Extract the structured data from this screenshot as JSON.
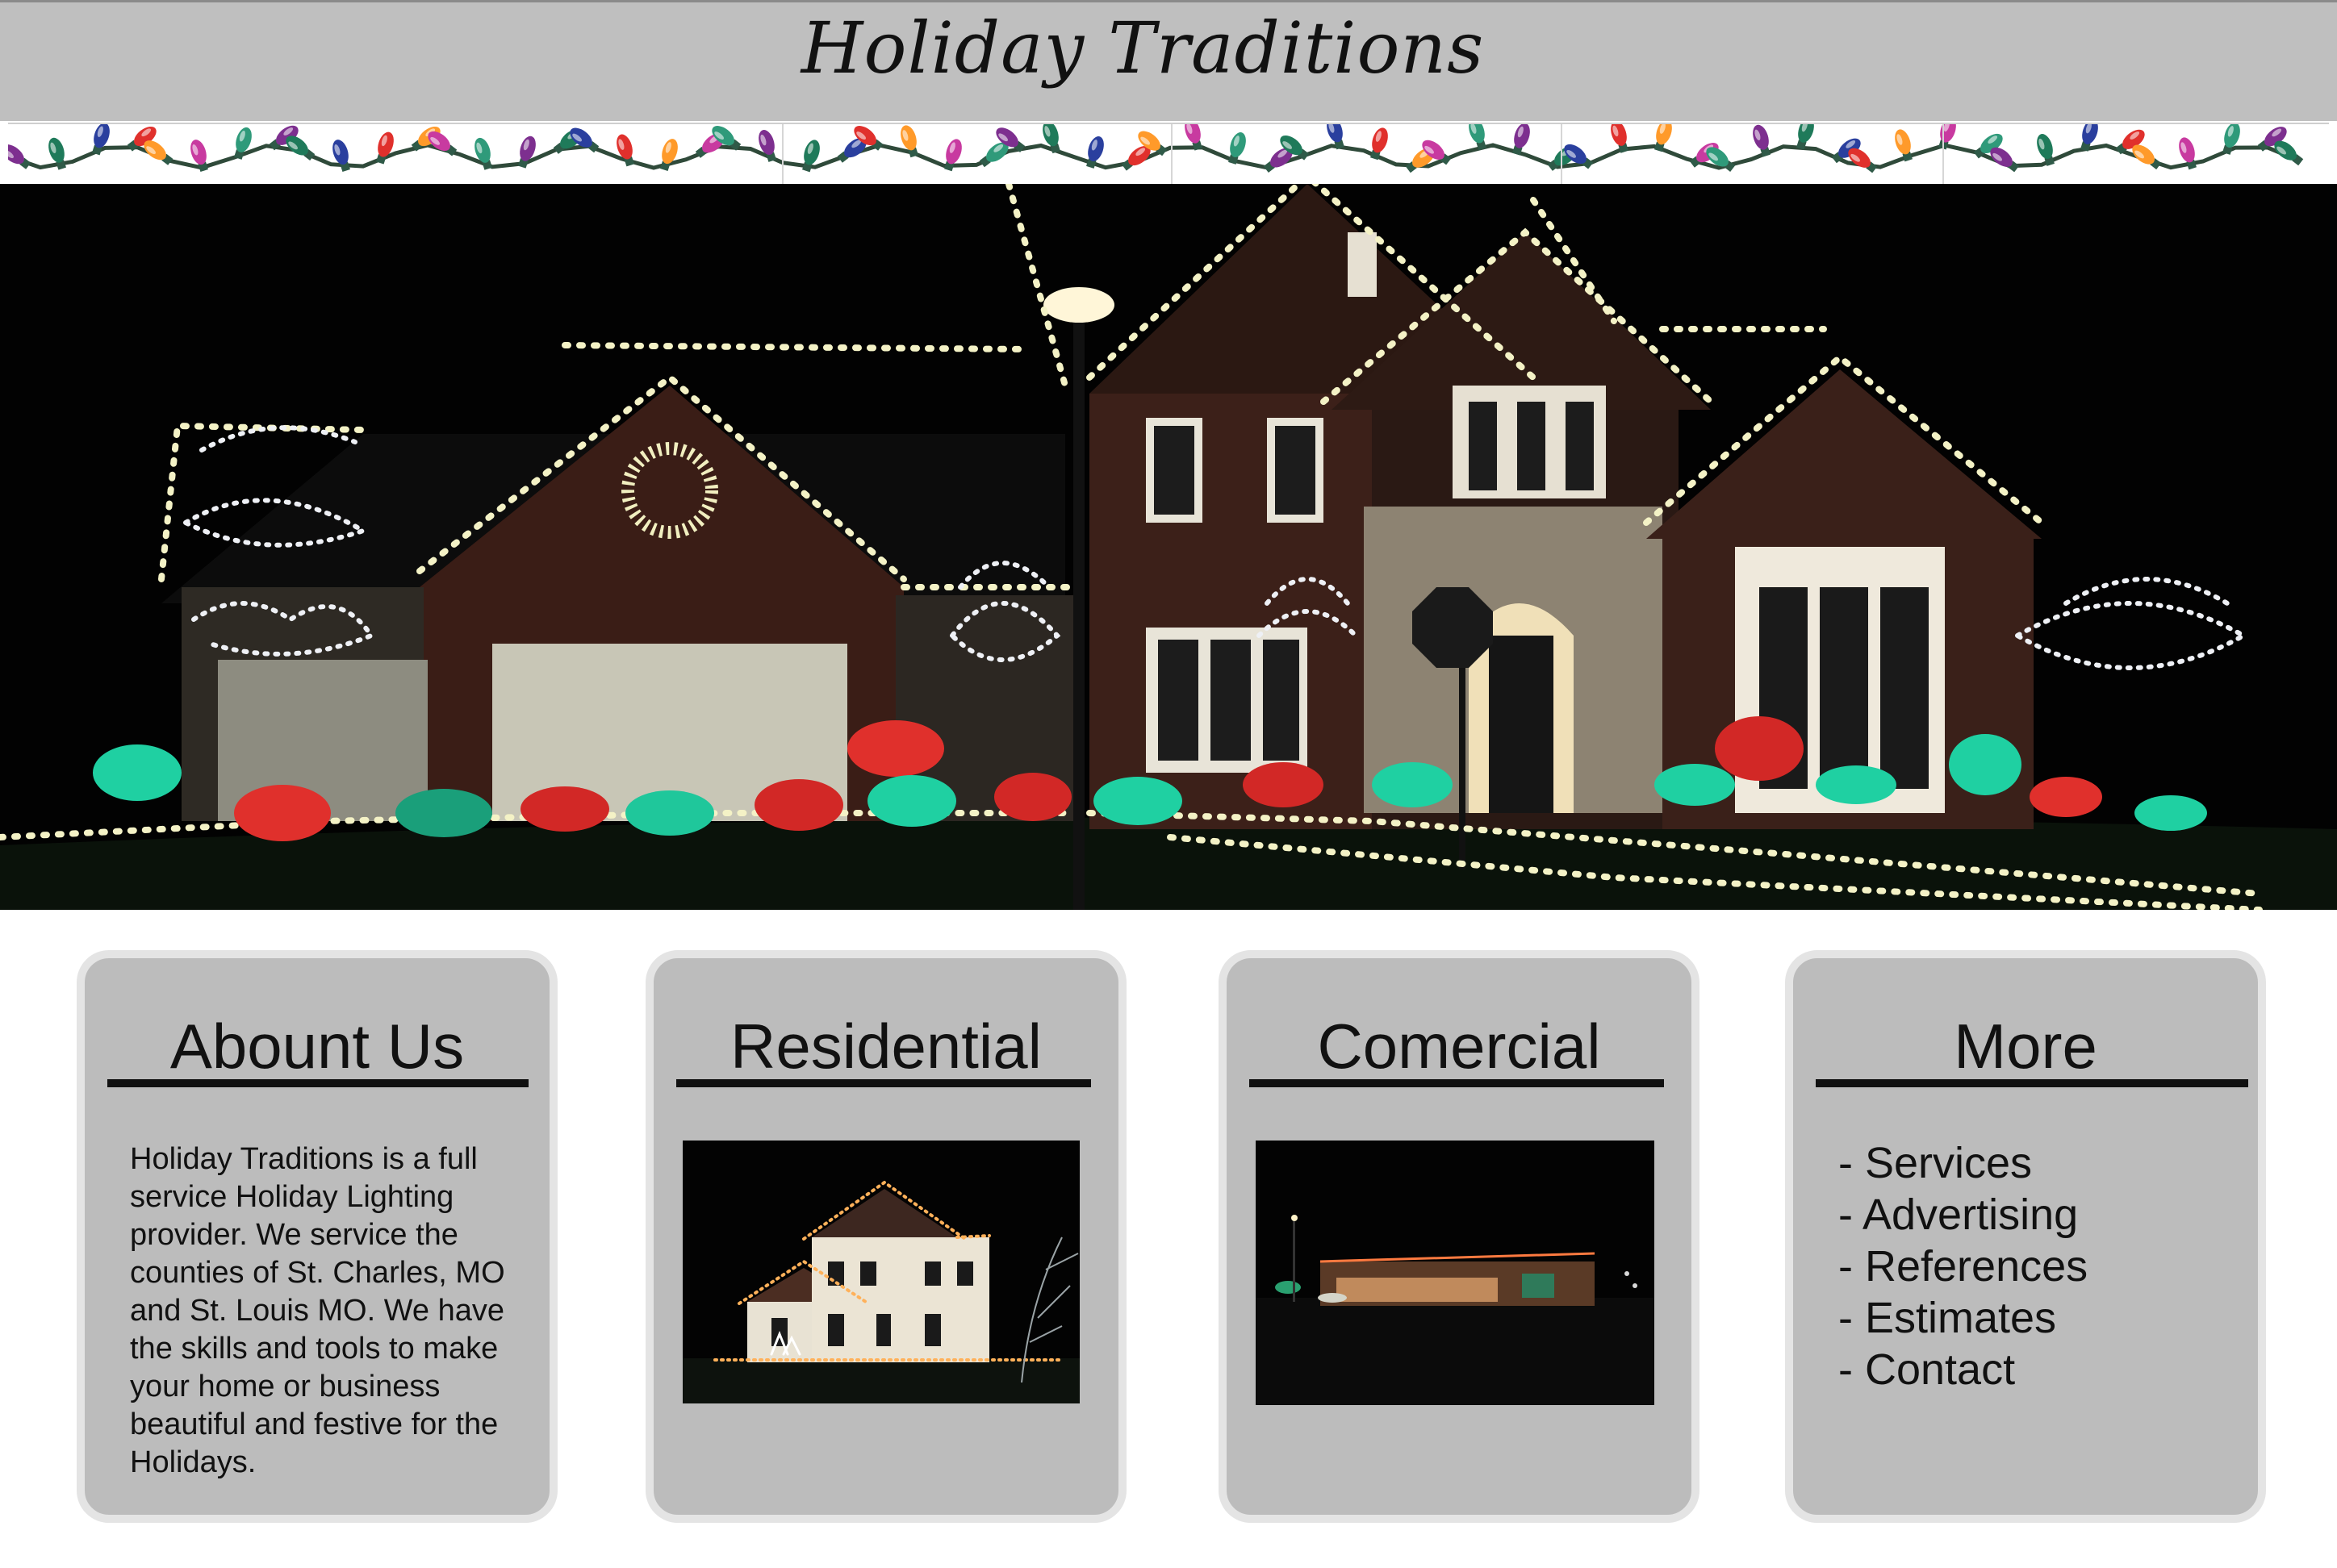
{
  "header": {
    "title": "Holiday Traditions"
  },
  "cards": [
    {
      "title": "Abount Us",
      "text": "Holiday Traditions is a full service Holiday Lighting provider. We service the counties of St. Charles, MO and St. Louis MO. We have the skills and tools to make your home or business beautiful and festive for the Holidays."
    },
    {
      "title": "Residential"
    },
    {
      "title": "Comercial"
    },
    {
      "title": "More",
      "links": [
        "- Services",
        "- Advertising",
        "- References",
        "- Estimates",
        "- Contact"
      ]
    }
  ],
  "colors": {
    "header_bg": "#bfbfbf",
    "card_bg": "#bcbcbc",
    "card_border": "#e4e4e4",
    "light_warm": "#f4f0c0",
    "light_red": "#d8262a",
    "light_green": "#1ecfa0"
  }
}
